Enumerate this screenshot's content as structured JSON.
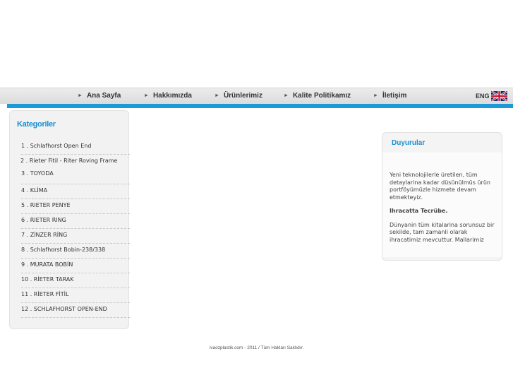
{
  "nav": {
    "items": [
      {
        "label": "Ana Sayfa"
      },
      {
        "label": "Hakkımızda"
      },
      {
        "label": "Ürünlerimiz"
      },
      {
        "label": "Kalite Politikamız"
      },
      {
        "label": "İletişim"
      }
    ],
    "lang_label": "ENG"
  },
  "categories": {
    "title": "Kategoriler",
    "items": [
      "1 . Schlafhorst Open End",
      "2 . Rieter Fitil - Riter Roving Frame",
      "3 . TOYODA",
      "4 . KLİMA",
      "5 . RIETER PENYE",
      "6 . RIETER RING",
      "7 . ZİNZER RİNG",
      "8 . Schlafhorst Bobin-238/338",
      "9 . MURATA BOBİN",
      "10 . RİETER TARAK",
      "11 . RİETER FİTİL",
      "12 . SCHLAFHORST OPEN-END"
    ]
  },
  "announcements": {
    "title": "Duyurular",
    "para1": "Yeni teknolojilerle üretilen, tüm detaylarina kadar düsünülmüs ürün portföyümüzle hizmete devam etmekteyiz.",
    "heading2": "Ihracatta Tecrübe.",
    "para2": "Dünyanin tüm kitalarina sorunsuz bir sekilde, tam zamanli olarak ihracatimiz mevcuttur. Mallarimiz"
  },
  "footer": "ivaozplastik.com - 2011 / Tüm Hakları Saklıdır.",
  "colors": {
    "accent": "#1a9ad6",
    "title_blue": "#1a8fd0",
    "panel_bg": "#f2f2f2"
  }
}
